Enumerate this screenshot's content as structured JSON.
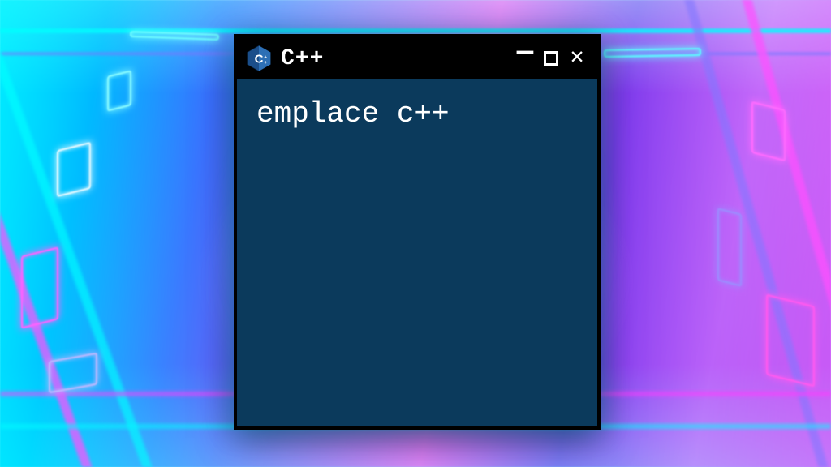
{
  "window": {
    "title": "C++",
    "icon_name": "cpp-hex-icon"
  },
  "terminal": {
    "content": "emplace c++"
  },
  "colors": {
    "terminal_bg": "#0b3a5c",
    "titlebar_bg": "#000000",
    "text": "#ffffff"
  }
}
